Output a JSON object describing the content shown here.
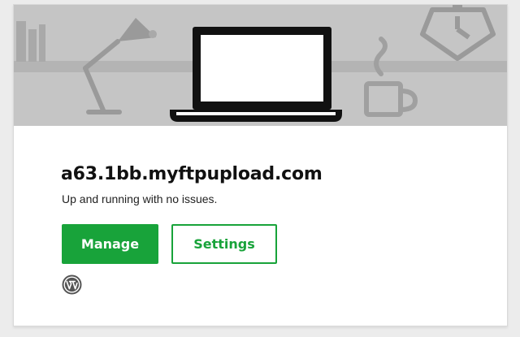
{
  "site": {
    "domain": "a63.1bb.myftpupload.com",
    "status": "Up and running with no issues."
  },
  "actions": {
    "manage_label": "Manage",
    "settings_label": "Settings"
  },
  "icons": {
    "hero": "laptop-on-desk-illustration",
    "platform": "wordpress-icon"
  },
  "colors": {
    "accent": "#18a33a",
    "hero_background": "#c5c5c5",
    "illustration_line": "#8a8a8a"
  }
}
